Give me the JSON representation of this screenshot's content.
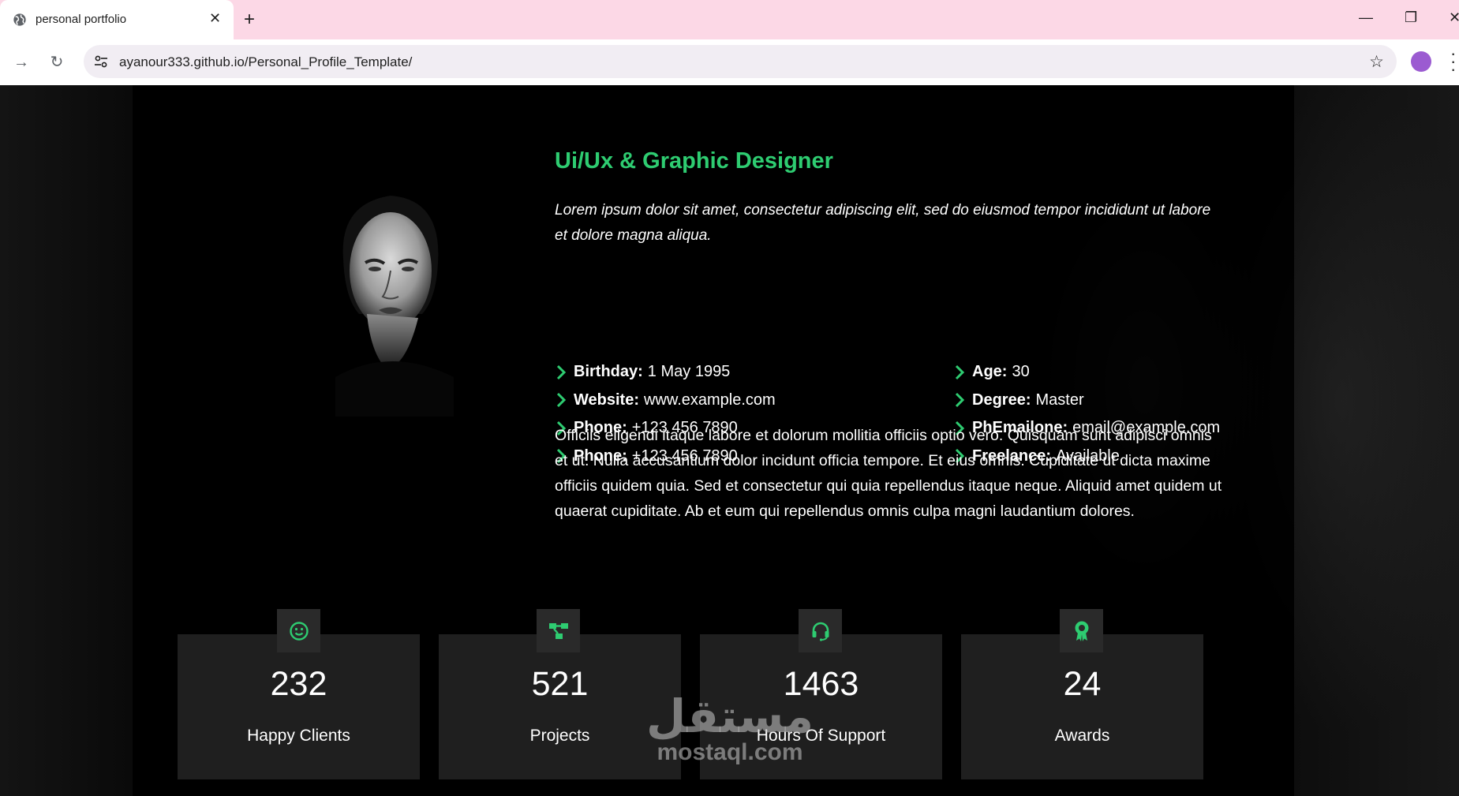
{
  "browser": {
    "tab_title": "personal portfolio",
    "tab_close": "✕",
    "new_tab": "+",
    "url": "ayanour333.github.io/Personal_Profile_Template/",
    "window": {
      "minimize": "—",
      "restore": "❐",
      "close": "✕"
    }
  },
  "hero": {
    "title": "Ui/Ux & Graphic Designer",
    "intro": "Lorem ipsum dolor sit amet, consectetur adipiscing elit, sed do eiusmod tempor incididunt ut labore et dolore magna aliqua.",
    "info_left": [
      {
        "label": "Birthday:",
        "value": "1 May 1995"
      },
      {
        "label": "Website:",
        "value": "www.example.com"
      },
      {
        "label": "Phone:",
        "value": "+123 456 7890"
      },
      {
        "label": "Phone:",
        "value": "+123 456 7890"
      }
    ],
    "info_right": [
      {
        "label": "Age:",
        "value": "30"
      },
      {
        "label": "Degree:",
        "value": "Master"
      },
      {
        "label": "PhEmailone:",
        "value": "email@example.com"
      },
      {
        "label": "Freelance:",
        "value": "Available"
      }
    ],
    "description": "Officiis eligendi itaque labore et dolorum mollitia officiis optio vero. Quisquam sunt adipisci omnis et ut. Nulla accusantium dolor incidunt officia tempore. Et eius omnis. Cupiditate ut dicta maxime officiis quidem quia. Sed et consectetur qui quia repellendus itaque neque. Aliquid amet quidem ut quaerat cupiditate. Ab et eum qui repellendus omnis culpa magni laudantium dolores."
  },
  "stats": [
    {
      "number": "232",
      "label": "Happy Clients",
      "icon": "smiley-icon"
    },
    {
      "number": "521",
      "label": "Projects",
      "icon": "diagram-icon"
    },
    {
      "number": "1463",
      "label": "Hours Of Support",
      "icon": "headset-icon"
    },
    {
      "number": "24",
      "label": "Awards",
      "icon": "award-icon"
    }
  ],
  "watermark": {
    "arabic": "مستقل",
    "latin": "mostaql.com"
  },
  "colors": {
    "accent": "#2ecc71",
    "chrome": "#fcd8e6",
    "card": "#1f1f1f",
    "icon_box": "#2a2a2a"
  }
}
